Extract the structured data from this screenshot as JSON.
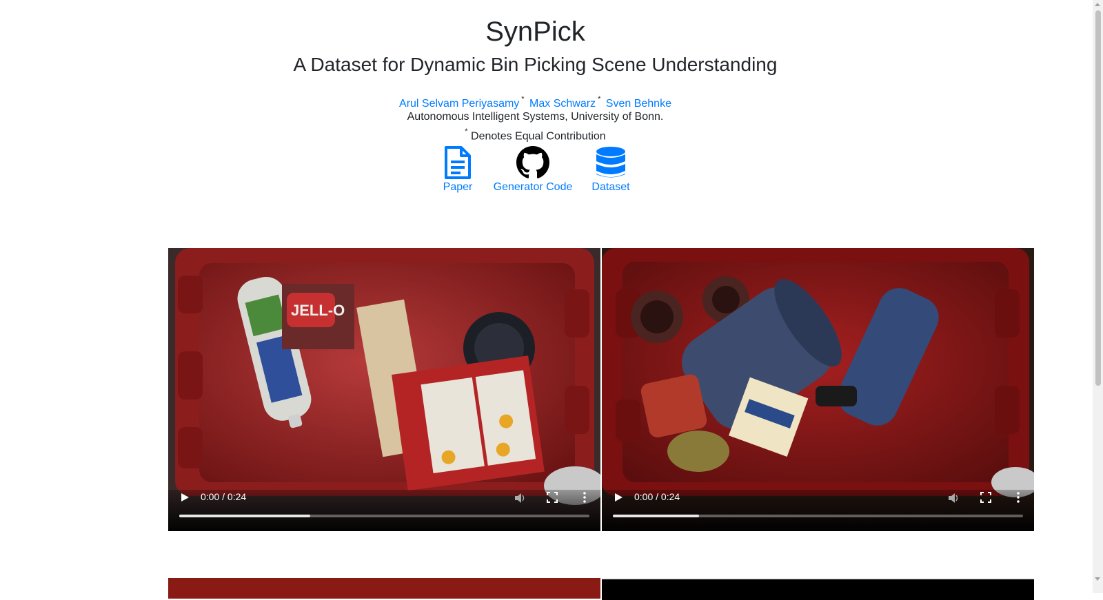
{
  "header": {
    "title": "SynPick",
    "subtitle": "A Dataset for Dynamic Bin Picking Scene Understanding"
  },
  "authors": [
    {
      "name": "Arul Selvam Periyasamy",
      "mark": "*"
    },
    {
      "name": "Max Schwarz",
      "mark": "*"
    },
    {
      "name": "Sven Behnke",
      "mark": ""
    }
  ],
  "affiliation": "Autonomous Intelligent Systems, University of Bonn.",
  "note": {
    "mark": "*",
    "text": "Denotes Equal Contribution"
  },
  "links": [
    {
      "label": "Paper",
      "icon": "document-icon"
    },
    {
      "label": "Generator Code",
      "icon": "github-icon"
    },
    {
      "label": "Dataset",
      "icon": "database-icon"
    }
  ],
  "videos": [
    {
      "time": "0:00 / 0:24",
      "buffered": 0.32
    },
    {
      "time": "0:00 / 0:24",
      "buffered": 0.21
    }
  ],
  "colors": {
    "link": "#007bff",
    "text": "#212529"
  }
}
